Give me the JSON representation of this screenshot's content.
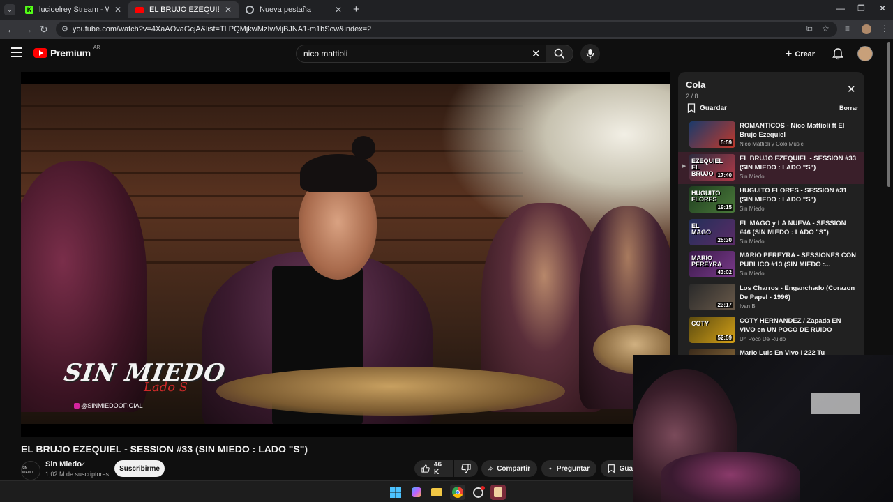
{
  "browser": {
    "tabs": [
      {
        "title": "lucioelrey Stream - Watch Live o",
        "favicon": "kick-icon",
        "favicon_color": "#53fc18"
      },
      {
        "title": "EL BRUJO EZEQUIEL - SESSION",
        "favicon": "youtube-icon",
        "favicon_color": "#ff0000",
        "active": true
      },
      {
        "title": "Nueva pestaña",
        "favicon": "chrome-icon",
        "favicon_color": "#bdc1c6"
      }
    ],
    "new_tab": "+",
    "url": "youtube.com/watch?v=4XaAOvaGcjA&list=TLPQMjkwMzIwMjBJNA1-m1bScw&index=2"
  },
  "youtube": {
    "logo_text": "Premium",
    "country": "AR",
    "search_value": "nico mattioli",
    "create_label": "Crear"
  },
  "video": {
    "title": "EL BRUJO EZEQUIEL - SESSION #33 (SIN MIEDO : LADO \"S\")",
    "watermark": "SIN MIEDO",
    "watermark_sub": "Lado S",
    "watermark_handle": "@SINMIEDOOFICIAL",
    "channel_avatar_text": "SIN MIEDO",
    "channel": "Sin Miedo",
    "subscribers": "1,02 M de suscriptores",
    "subscribe_label": "Suscribirme",
    "likes": "46 K",
    "share_label": "Compartir",
    "ask_label": "Preguntar",
    "save_label": "Guar"
  },
  "queue": {
    "title": "Cola",
    "position": "2 / 8",
    "save_label": "Guardar",
    "clear_label": "Borrar",
    "items": [
      {
        "title": "ROMANTICOS - Nico Mattioli ft El Brujo Ezequiel",
        "channel": "Nico Mattioli y Colo Music",
        "duration": "5:59",
        "thumb_text": "",
        "color1": "#1b3a6b",
        "color2": "#c0392b"
      },
      {
        "title": "EL BRUJO EZEQUIEL - SESSION #33 (SIN MIEDO : LADO \"S\")",
        "channel": "Sin Miedo",
        "duration": "17:40",
        "thumb_text": "EZEQUIEL EL BRUJO",
        "color1": "#2c2c3e",
        "color2": "#b23a48",
        "active": true
      },
      {
        "title": "HUGUITO FLORES - SESSION #31 (SIN MIEDO : LADO \"S\")",
        "channel": "Sin Miedo",
        "duration": "19:15",
        "thumb_text": "HUGUITO FLORES",
        "color1": "#1f3d1f",
        "color2": "#4a7a3a"
      },
      {
        "title": "EL MAGO y LA NUEVA - SESSION #46 (SIN MIEDO : LADO \"S\")",
        "channel": "Sin Miedo",
        "duration": "25:30",
        "thumb_text": "EL MAGO",
        "color1": "#23305a",
        "color2": "#5b2b66"
      },
      {
        "title": "MARIO PEREYRA - SESSIONES CON PUBLICO #13 (SIN MIEDO :...",
        "channel": "Sin Miedo",
        "duration": "43:02",
        "thumb_text": "MARIO PEREYRA",
        "color1": "#3a1a4a",
        "color2": "#7a3a8a"
      },
      {
        "title": "Los Charros - Enganchado (Corazon De Papel - 1996)",
        "channel": "Ivan B",
        "duration": "23:17",
        "thumb_text": "",
        "color1": "#2a2a2a",
        "color2": "#6a5a4a"
      },
      {
        "title": "COTY HERNANDEZ / Zapada EN VIVO en UN POCO DE RUIDO",
        "channel": "Un Poco De Ruido",
        "duration": "52:59",
        "thumb_text": "COTY",
        "color1": "#5a4a10",
        "color2": "#d4a017"
      },
      {
        "title": "Mario Luis En Vivo | 222 Tu",
        "channel": "",
        "duration": "",
        "thumb_text": "",
        "color1": "#3a2a1a",
        "color2": "#8a6a3a"
      }
    ]
  }
}
